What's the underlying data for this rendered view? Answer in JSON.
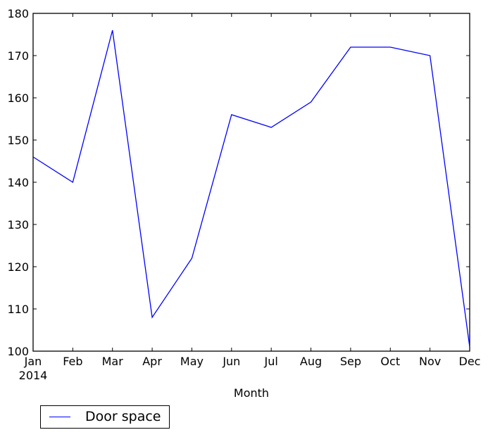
{
  "chart_data": {
    "type": "line",
    "title": "",
    "xlabel": "Month",
    "ylabel": "",
    "categories": [
      "Jan",
      "Feb",
      "Mar",
      "Apr",
      "May",
      "Jun",
      "Jul",
      "Aug",
      "Sep",
      "Oct",
      "Nov",
      "Dec"
    ],
    "x_tick_labels": [
      "Jan\n2014",
      "Feb",
      "Mar",
      "Apr",
      "May",
      "Jun",
      "Jul",
      "Aug",
      "Sep",
      "Oct",
      "Nov",
      "Dec"
    ],
    "x_year_label": "2014",
    "y_ticks": [
      100,
      110,
      120,
      130,
      140,
      150,
      160,
      170,
      180
    ],
    "ylim": [
      100,
      180
    ],
    "grid": false,
    "series": [
      {
        "name": "Door space",
        "color": "#0000ff",
        "values": [
          146,
          140,
          176,
          108,
          122,
          156,
          153,
          159,
          172,
          172,
          170,
          101
        ]
      }
    ],
    "legend": {
      "entries": [
        "Door space"
      ],
      "placement": "below-left"
    }
  }
}
